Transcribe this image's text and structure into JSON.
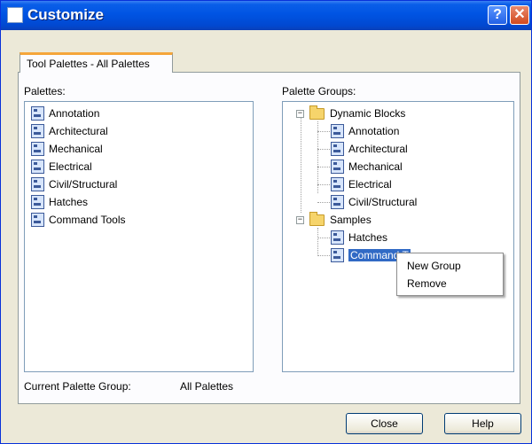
{
  "window": {
    "title": "Customize",
    "help_glyph": "?",
    "close_glyph": "✕"
  },
  "tab": {
    "label": "Tool Palettes - All Palettes"
  },
  "palettes": {
    "label": "Palettes:",
    "items": [
      "Annotation",
      "Architectural",
      "Mechanical",
      "Electrical",
      "Civil/Structural",
      "Hatches",
      "Command Tools"
    ]
  },
  "palette_groups": {
    "label": "Palette Groups:",
    "expander_minus": "−",
    "groups": [
      {
        "name": "Dynamic Blocks",
        "items": [
          "Annotation",
          "Architectural",
          "Mechanical",
          "Electrical",
          "Civil/Structural"
        ]
      },
      {
        "name": "Samples",
        "items": [
          "Hatches",
          "Command Tools"
        ]
      }
    ],
    "selected_visible_text": "Command T"
  },
  "context_menu": {
    "items": [
      "New Group",
      "Remove"
    ]
  },
  "current_group": {
    "label": "Current Palette Group:",
    "value": "All Palettes"
  },
  "buttons": {
    "close": "Close",
    "help": "Help"
  }
}
